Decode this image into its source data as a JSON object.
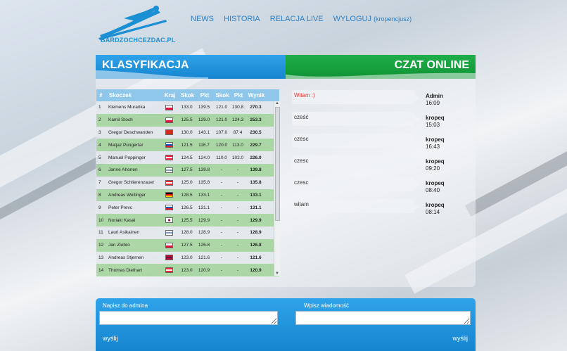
{
  "site": {
    "logo_text": "BARDZOCHCEZDAC.PL"
  },
  "nav": {
    "items": [
      "NEWS",
      "HISTORIA",
      "RELACJA LIVE",
      "WYLOGUJ"
    ],
    "user": "(kropencjusz)"
  },
  "classification": {
    "title": "KLASYFIKACJA",
    "columns": [
      "#",
      "Skoczek",
      "Kraj",
      "Skok",
      "Pkt",
      "Skok",
      "Pkt",
      "Wynik"
    ],
    "rows": [
      {
        "n": "1",
        "name": "Klemens Murańka",
        "flag": "pl",
        "s1": "133.0",
        "p1": "139.5",
        "s2": "121.0",
        "p2": "130.8",
        "total": "270.3"
      },
      {
        "n": "2",
        "name": "Kamil Stoch",
        "flag": "pl",
        "s1": "125.5",
        "p1": "129.0",
        "s2": "121.0",
        "p2": "124.3",
        "total": "253.3"
      },
      {
        "n": "3",
        "name": "Gregor Deschwanden",
        "flag": "ch",
        "s1": "130.0",
        "p1": "143.1",
        "s2": "107.0",
        "p2": "87.4",
        "total": "230.5"
      },
      {
        "n": "4",
        "name": "Matjaz Pungertar",
        "flag": "si",
        "s1": "121.5",
        "p1": "116.7",
        "s2": "120.0",
        "p2": "113.0",
        "total": "229.7"
      },
      {
        "n": "5",
        "name": "Manuel Poppinger",
        "flag": "at",
        "s1": "124.5",
        "p1": "124.0",
        "s2": "110.0",
        "p2": "102.0",
        "total": "226.0"
      },
      {
        "n": "6",
        "name": "Janne Ahonen",
        "flag": "fi",
        "s1": "127.5",
        "p1": "139.8",
        "s2": "-",
        "p2": "-",
        "total": "139.8"
      },
      {
        "n": "7",
        "name": "Gregor Schlierenzauer",
        "flag": "at",
        "s1": "125.0",
        "p1": "135.8",
        "s2": "-",
        "p2": "-",
        "total": "135.8"
      },
      {
        "n": "8",
        "name": "Andreas Wellinger",
        "flag": "de",
        "s1": "128.5",
        "p1": "133.1",
        "s2": "-",
        "p2": "-",
        "total": "133.1"
      },
      {
        "n": "9",
        "name": "Peter Prevc",
        "flag": "si",
        "s1": "126.5",
        "p1": "131.1",
        "s2": "-",
        "p2": "-",
        "total": "131.1"
      },
      {
        "n": "10",
        "name": "Noriaki Kasai",
        "flag": "jp",
        "s1": "125.5",
        "p1": "129.9",
        "s2": "-",
        "p2": "-",
        "total": "129.9"
      },
      {
        "n": "11",
        "name": "Lauri Asikainen",
        "flag": "fi",
        "s1": "128.0",
        "p1": "128.9",
        "s2": "-",
        "p2": "-",
        "total": "128.9"
      },
      {
        "n": "12",
        "name": "Jan Ziobro",
        "flag": "pl",
        "s1": "127.5",
        "p1": "126.8",
        "s2": "-",
        "p2": "-",
        "total": "126.8"
      },
      {
        "n": "13",
        "name": "Andreas Stjernen",
        "flag": "no",
        "s1": "123.0",
        "p1": "121.6",
        "s2": "-",
        "p2": "-",
        "total": "121.6"
      },
      {
        "n": "14",
        "name": "Thomas Diethart",
        "flag": "at",
        "s1": "123.0",
        "p1": "120.9",
        "s2": "-",
        "p2": "-",
        "total": "120.9"
      }
    ]
  },
  "chat": {
    "title": "CZAT ONLINE",
    "messages": [
      {
        "text": "Witam :)",
        "author": "Admin",
        "time": "16:09",
        "admin": true
      },
      {
        "text": "cześć",
        "author": "kropeq",
        "time": "15:03",
        "admin": false
      },
      {
        "text": "czesc",
        "author": "kropeq",
        "time": "16:43",
        "admin": false
      },
      {
        "text": "czesc",
        "author": "kropeq",
        "time": "09:20",
        "admin": false
      },
      {
        "text": "czesc",
        "author": "kropeq",
        "time": "08:40",
        "admin": false
      },
      {
        "text": "witam",
        "author": "kropeq",
        "time": "08:14",
        "admin": false
      }
    ]
  },
  "form": {
    "admin_label": "Napisz do admina",
    "message_label": "Wpisz wiadomość",
    "send_label": "wyślij"
  },
  "colors": {
    "blue": "#1b8fd4",
    "green": "#15a03f",
    "admin_text": "#e53935"
  }
}
